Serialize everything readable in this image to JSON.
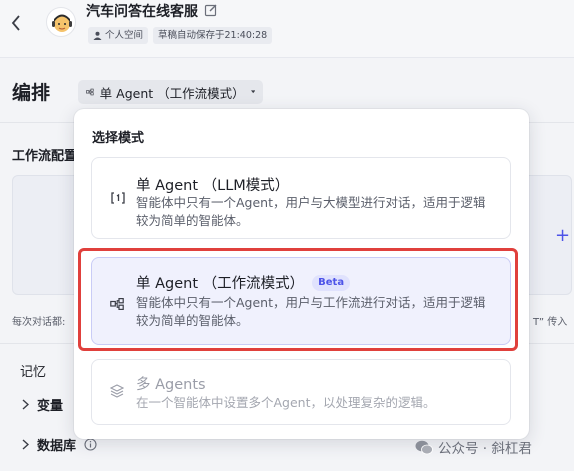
{
  "header": {
    "app_title": "汽车问答在线客服",
    "workspace_badge": "个人空间",
    "autosave_badge": "草稿自动保存于21:40:28"
  },
  "main": {
    "section_title": "编排",
    "mode_select_value": "单 Agent （工作流模式）",
    "workflow_config_label": "工作流配置",
    "hint_left": "每次对话都:",
    "hint_right": "T” 传入",
    "memory_label": "记忆",
    "variables_label": "变量",
    "database_label": "数据库"
  },
  "dropdown": {
    "title": "选择模式",
    "options": [
      {
        "icon": "llm-mode-icon",
        "name": "单 Agent （LLM模式）",
        "description": "智能体中只有一个Agent，用户与大模型进行对话，适用于逻辑较为简单的智能体。"
      },
      {
        "icon": "workflow-mode-icon",
        "name": "单 Agent （工作流模式）",
        "badge": "Beta",
        "description": "智能体中只有一个Agent，用户与工作流进行对话，适用于逻辑较为简单的智能体。"
      },
      {
        "icon": "multi-agent-icon",
        "name": "多 Agents",
        "description": "在一个智能体中设置多个Agent，以处理复杂的逻辑。"
      }
    ]
  },
  "watermark": "公众号 · 斜杠君",
  "colors": {
    "accent": "#4d53e8",
    "highlight": "#e0403c",
    "selected_bg": "#f0f1fd"
  }
}
